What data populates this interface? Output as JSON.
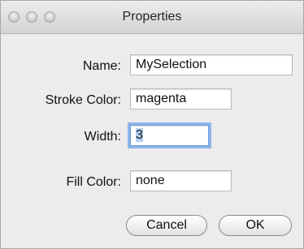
{
  "window": {
    "title": "Properties"
  },
  "form": {
    "name_label": "Name:",
    "name_value": "MySelection",
    "stroke_label": "Stroke Color:",
    "stroke_value": "magenta",
    "width_label": "Width:",
    "width_value": "3",
    "fill_label": "Fill Color:",
    "fill_value": "none"
  },
  "buttons": {
    "cancel": "Cancel",
    "ok": "OK"
  }
}
